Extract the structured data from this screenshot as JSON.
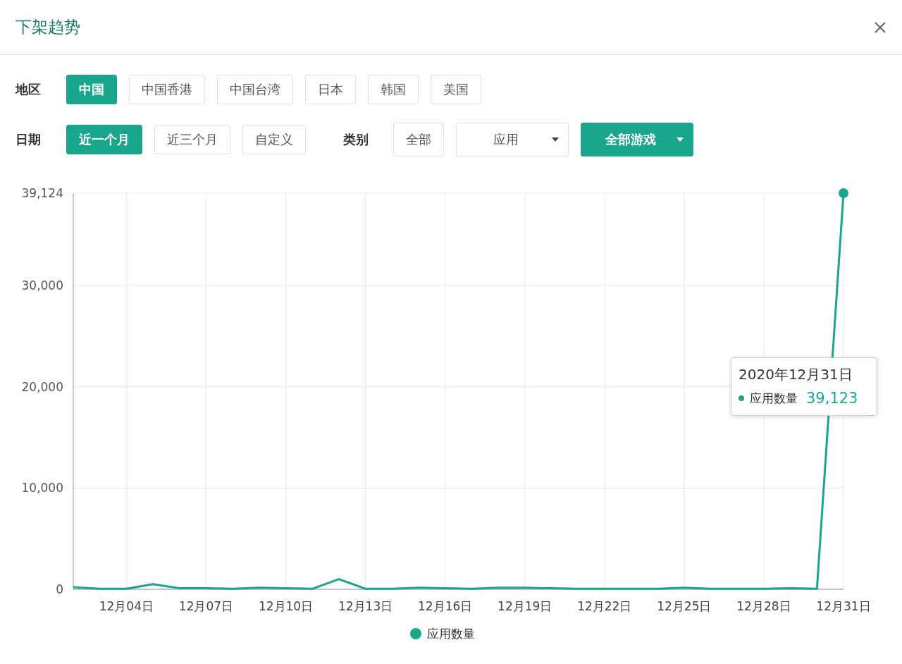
{
  "dialog": {
    "title": "下架趋势"
  },
  "filters": {
    "region": {
      "label": "地区",
      "options": [
        {
          "label": "中国",
          "selected": true
        },
        {
          "label": "中国香港",
          "selected": false
        },
        {
          "label": "中国台湾",
          "selected": false
        },
        {
          "label": "日本",
          "selected": false
        },
        {
          "label": "韩国",
          "selected": false
        },
        {
          "label": "美国",
          "selected": false
        }
      ]
    },
    "date": {
      "label": "日期",
      "options": [
        {
          "label": "近一个月",
          "selected": true
        },
        {
          "label": "近三个月",
          "selected": false
        },
        {
          "label": "自定义",
          "selected": false
        }
      ]
    },
    "category": {
      "label": "类别",
      "options": [
        {
          "label": "全部",
          "kind": "button",
          "selected": false
        },
        {
          "label": "应用",
          "kind": "dropdown",
          "selected": false
        },
        {
          "label": "全部游戏",
          "kind": "dropdown",
          "selected": true
        }
      ]
    }
  },
  "chart": {
    "chart_data": {
      "type": "line",
      "grid": true,
      "categories": [
        null,
        null,
        "12月04日",
        null,
        null,
        "12月07日",
        null,
        null,
        "12月10日",
        null,
        null,
        "12月13日",
        null,
        null,
        "12月16日",
        null,
        null,
        "12月19日",
        null,
        null,
        "12月22日",
        null,
        null,
        "12月25日",
        null,
        null,
        "12月28日",
        null,
        null,
        "12月31日"
      ],
      "series": [
        {
          "name": "应用数量",
          "color": "#1aa68c",
          "values": [
            200,
            50,
            50,
            500,
            100,
            100,
            50,
            150,
            100,
            50,
            1000,
            50,
            50,
            150,
            100,
            50,
            150,
            150,
            100,
            50,
            50,
            50,
            50,
            150,
            50,
            50,
            50,
            100,
            50,
            39123
          ]
        }
      ],
      "ylim": [
        0,
        39124
      ],
      "legend": true,
      "yticks": [
        {
          "value": 0,
          "label": "0"
        },
        {
          "value": 10000,
          "label": "10,000"
        },
        {
          "value": 20000,
          "label": "20,000"
        },
        {
          "value": 30000,
          "label": "30,000"
        },
        {
          "value": 39124,
          "label": "39,124"
        }
      ]
    },
    "tooltip": {
      "title": "2020年12月31日",
      "series_name": "应用数量",
      "value": "39,123"
    }
  }
}
